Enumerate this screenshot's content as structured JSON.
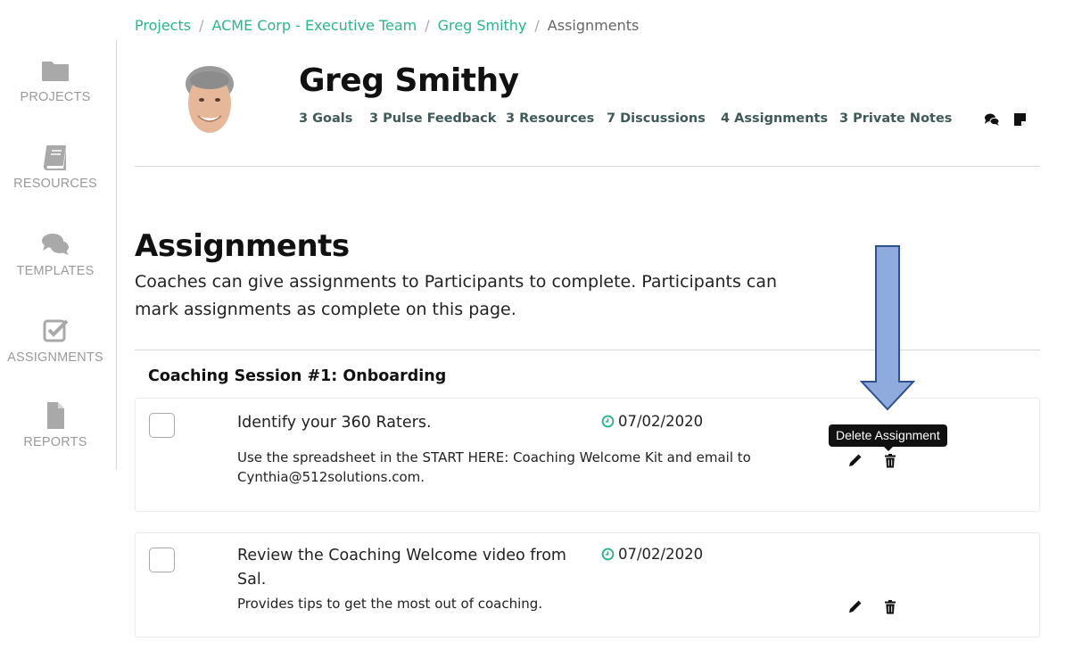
{
  "breadcrumb": {
    "items": [
      "Projects",
      "ACME Corp - Executive Team",
      "Greg Smithy"
    ],
    "separator": "/",
    "current": "Assignments"
  },
  "sidebar": {
    "items": [
      {
        "label": "PROJECTS",
        "icon": "folder-icon"
      },
      {
        "label": "RESOURCES",
        "icon": "book-icon"
      },
      {
        "label": "TEMPLATES",
        "icon": "comments-icon"
      },
      {
        "label": "ASSIGNMENTS",
        "icon": "check-square-icon"
      },
      {
        "label": "REPORTS",
        "icon": "file-icon"
      }
    ]
  },
  "profile": {
    "name": "Greg Smithy",
    "stats": [
      "3 Goals",
      "3 Pulse Feedback",
      "3 Resources",
      "7 Discussions",
      "4 Assignments",
      "3 Private Notes"
    ],
    "icons": [
      "comments-icon",
      "sticky-note-icon"
    ]
  },
  "section": {
    "title": "Assignments",
    "description": "Coaches can give assignments to Participants to complete. Participants can mark assignments as complete on this page."
  },
  "group": {
    "title": "Coaching Session #1: Onboarding"
  },
  "assignments": [
    {
      "title": "Identify your 360 Raters.",
      "description": "Use the spreadsheet in the START HERE: Coaching Welcome Kit and email to Cynthia@512solutions.com.",
      "date": "07/02/2020"
    },
    {
      "title": "Review the Coaching Welcome video from Sal.",
      "description": "Provides tips to get the most out of coaching.",
      "date": "07/02/2020"
    }
  ],
  "tooltip": {
    "text": "Delete Assignment"
  },
  "colors": {
    "accent": "#2bb58b",
    "stat_text": "#3f5959",
    "sidebar_text": "#9a9a9a",
    "arrow_fill": "#8faadc",
    "arrow_stroke": "#2f528f"
  }
}
